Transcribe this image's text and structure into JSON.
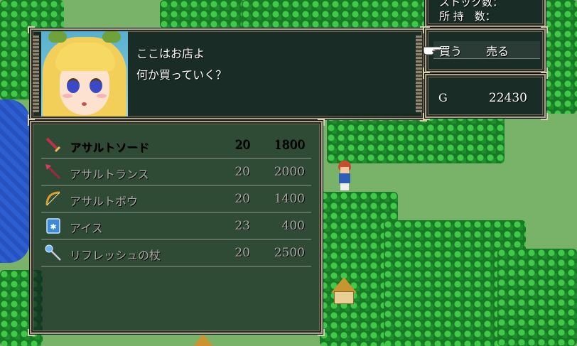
{
  "top_status": {
    "stock_label": "ストック数：",
    "owned_label": "所 持　数："
  },
  "dialog": {
    "line1": "ここはお店よ",
    "line2": "何か買っていく？"
  },
  "command_menu": {
    "buy": "買う",
    "sell": "売る",
    "selected": "buy"
  },
  "gold": {
    "label": "G",
    "value": "22430"
  },
  "shop_items": [
    {
      "icon": "sword-icon",
      "name": "アサルトソード",
      "stock": "20",
      "price": "1800",
      "enabled": true
    },
    {
      "icon": "spear-icon",
      "name": "アサルトランス",
      "stock": "20",
      "price": "2000",
      "enabled": false
    },
    {
      "icon": "bow-icon",
      "name": "アサルトボウ",
      "stock": "20",
      "price": "1400",
      "enabled": false
    },
    {
      "icon": "book-icon",
      "name": "アイス",
      "stock": "23",
      "price": "400",
      "enabled": false
    },
    {
      "icon": "staff-icon",
      "name": "リフレッシュの杖",
      "stock": "20",
      "price": "2500",
      "enabled": false
    }
  ],
  "colors": {
    "window_bg": "#122121",
    "window_border": "#a8a38c",
    "text": "#ffffff",
    "disabled_text": "#a9aaa6"
  }
}
